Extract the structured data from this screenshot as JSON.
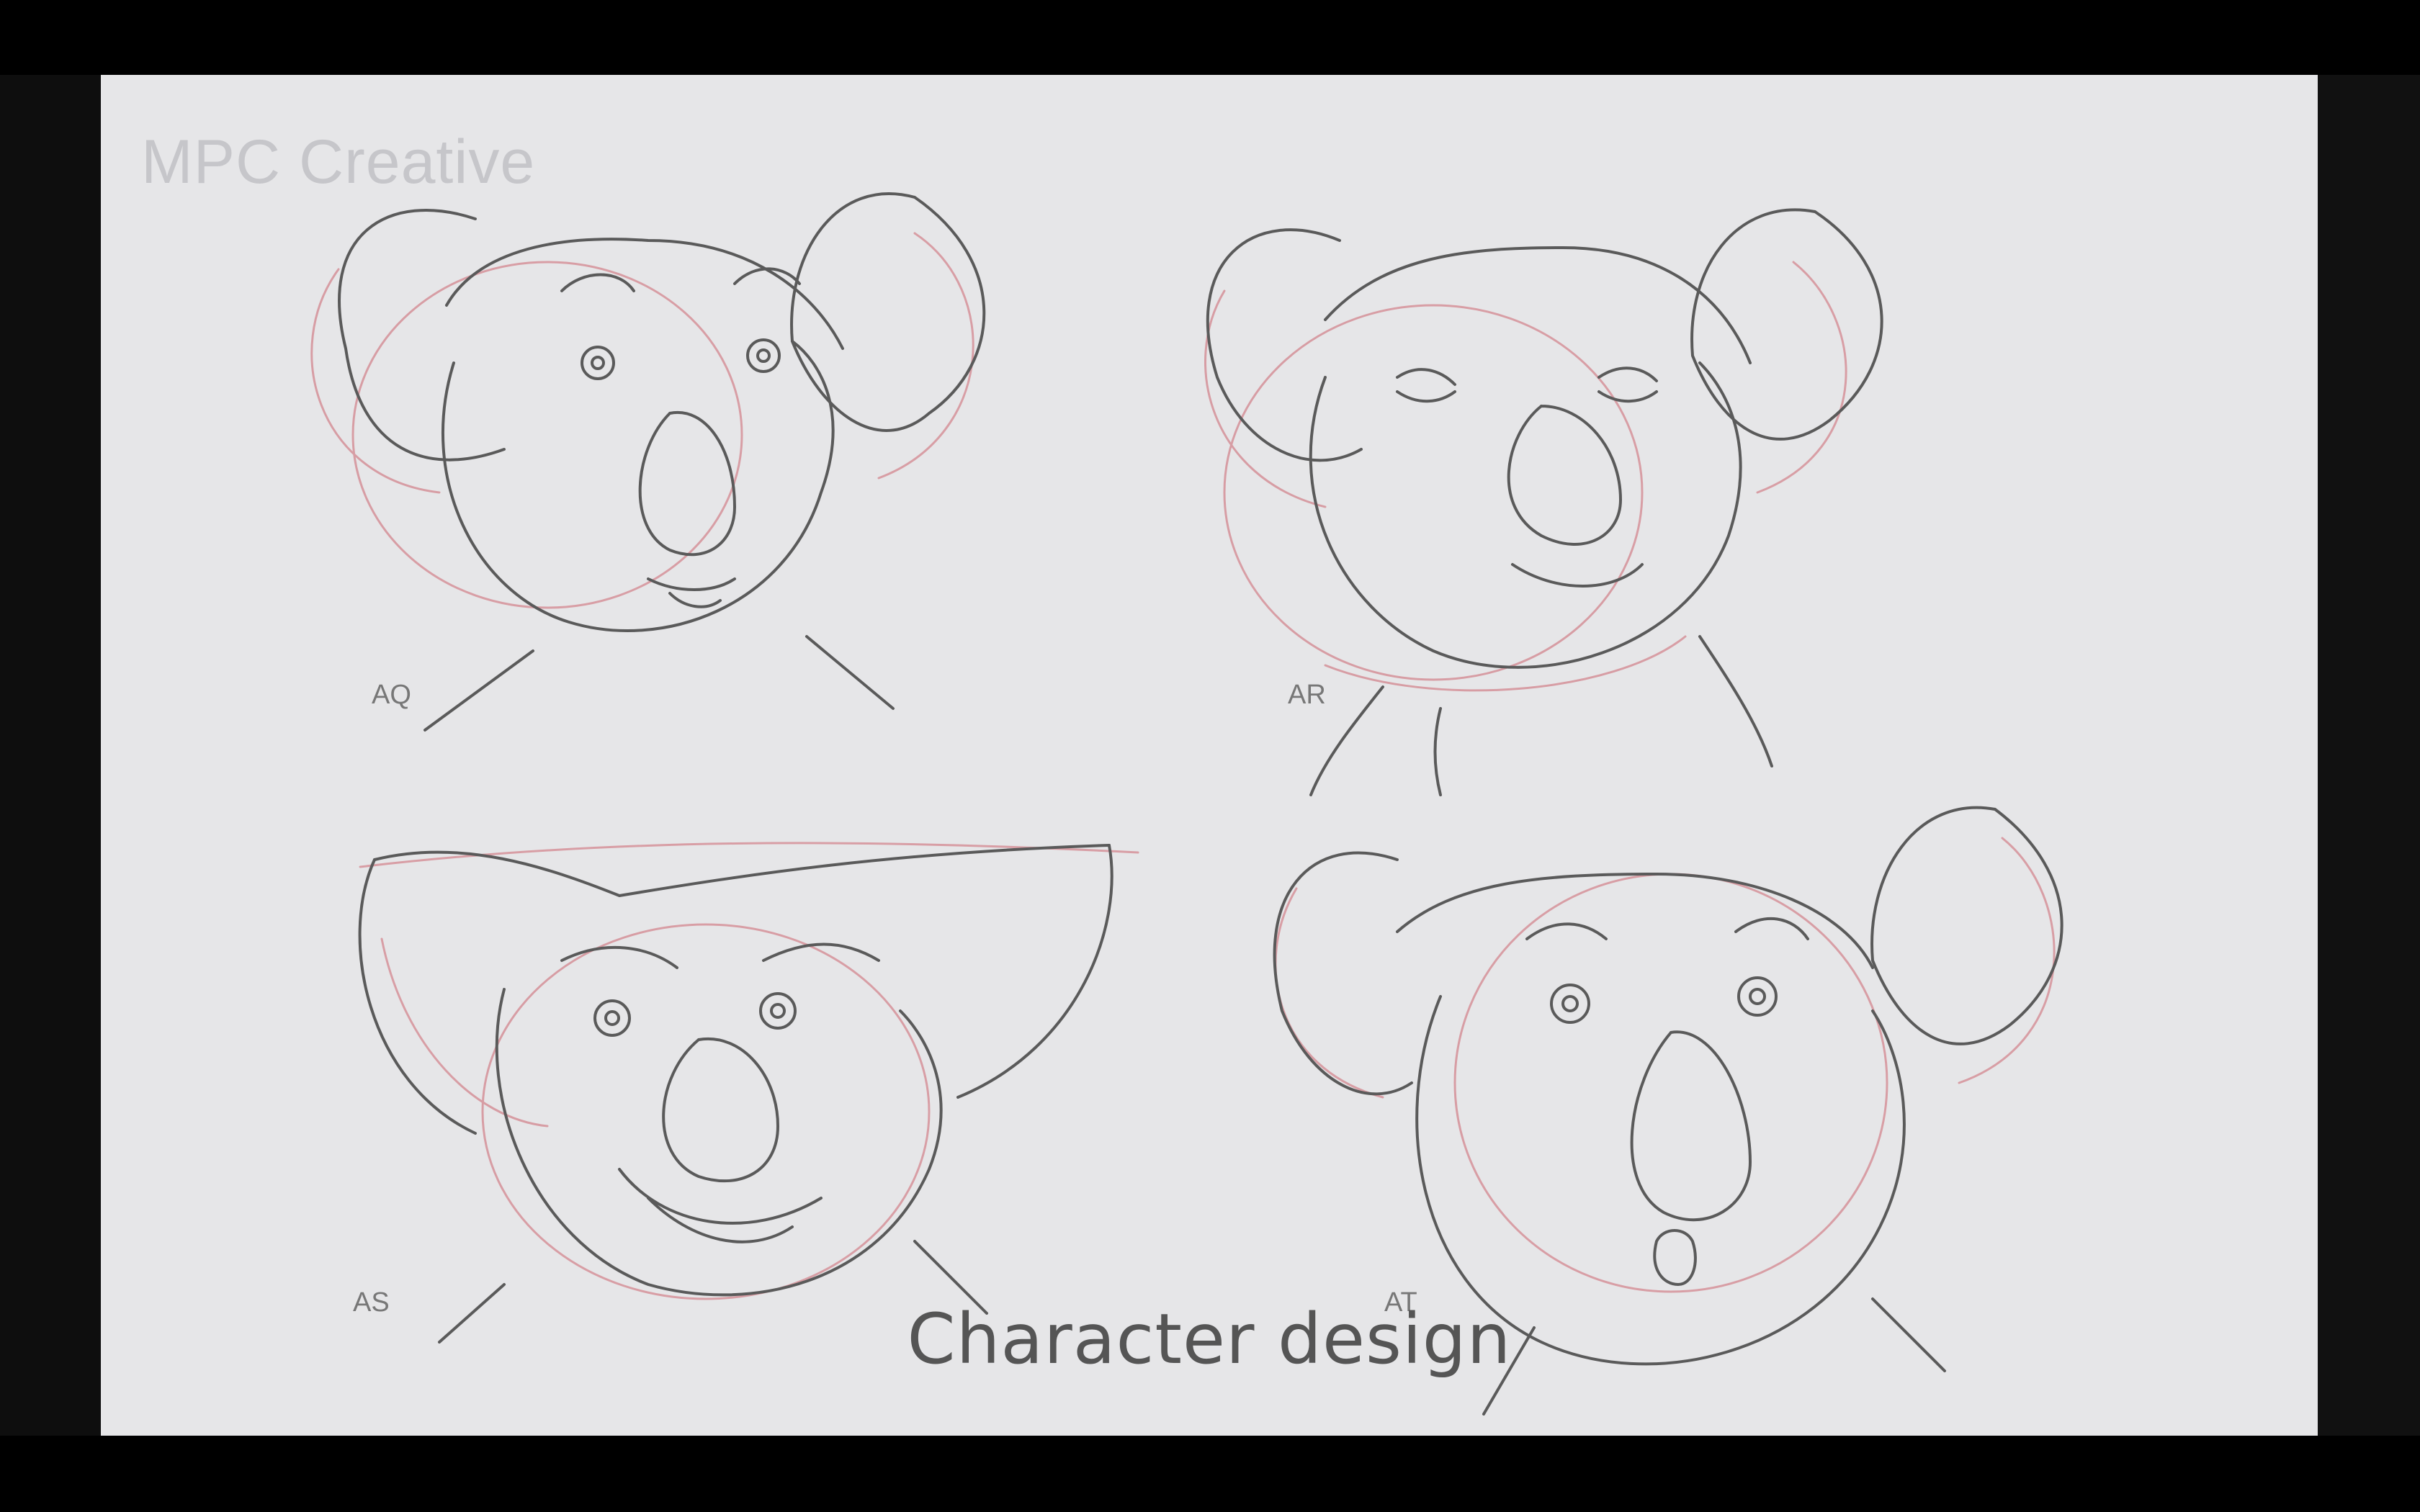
{
  "slide": {
    "brand": "MPC Creative",
    "caption": "Character design",
    "panels": [
      {
        "label": "AQ",
        "expression": "neutral"
      },
      {
        "label": "AR",
        "expression": "smiling"
      },
      {
        "label": "AS",
        "expression": "grinning"
      },
      {
        "label": "AT",
        "expression": "surprised"
      }
    ]
  },
  "colors": {
    "paper": "#e6e6e8",
    "pencil": "#555555",
    "red_construction": "#d48c94",
    "letterbox": "#000000"
  }
}
